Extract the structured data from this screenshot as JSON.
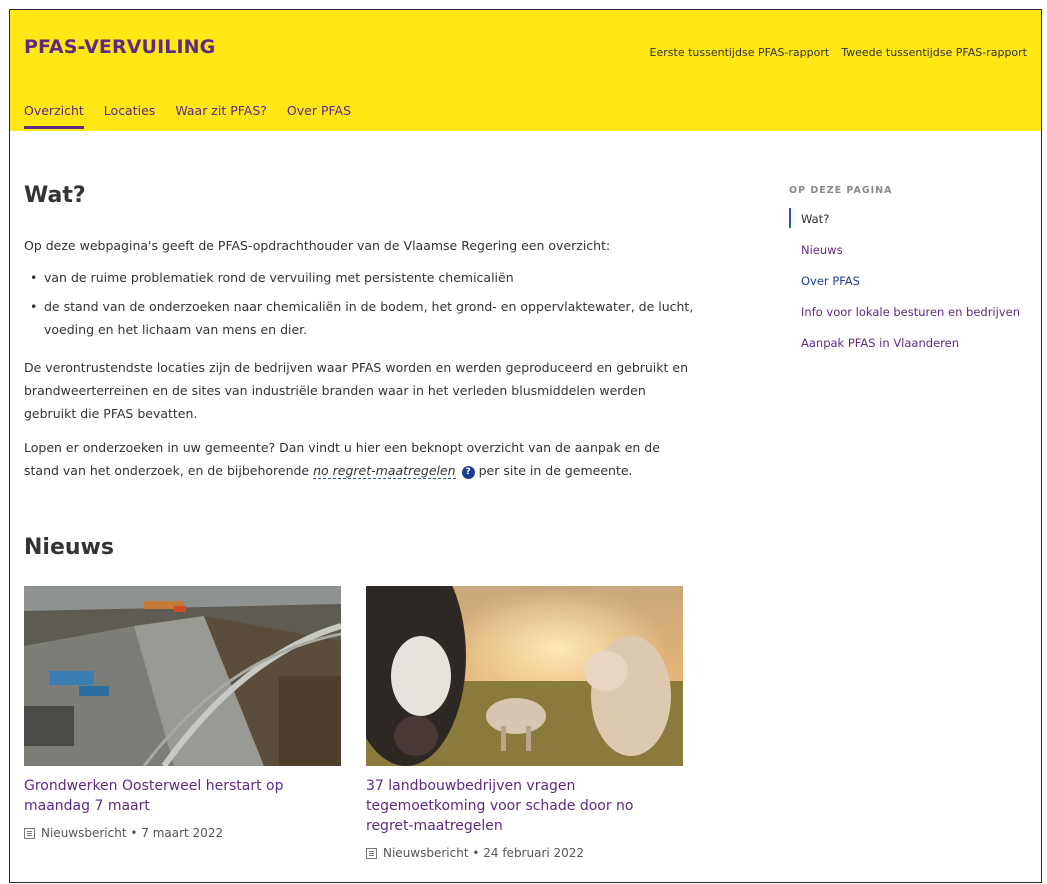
{
  "header": {
    "site_title": "PFAS-VERVUILING",
    "top_links": [
      "Eerste tussentijdse PFAS-rapport",
      "Tweede tussentijdse PFAS-rapport"
    ],
    "nav": [
      "Overzicht",
      "Locaties",
      "Waar zit PFAS?",
      "Over PFAS"
    ],
    "active_nav": "Overzicht"
  },
  "wat": {
    "title": "Wat?",
    "intro": "Op deze webpagina's geeft de PFAS-opdrachthouder van de Vlaamse Regering een overzicht:",
    "bullets": [
      "van de ruime problematiek rond de vervuiling met persistente chemicaliën",
      "de stand van de onderzoeken naar chemicaliën in de bodem, het grond- en oppervlaktewater, de lucht, voeding en het lichaam van mens en dier."
    ],
    "paragraph2": "De verontrustendste locaties zijn de bedrijven waar PFAS worden en werden geproduceerd en gebruikt en brandweerterreinen en de sites van industriële branden waar in het verleden blusmiddelen werden gebruikt die PFAS bevatten.",
    "paragraph3_before": "Lopen er onderzoeken in uw gemeente? Dan vindt u hier een beknopt overzicht van de aanpak en de stand van het onderzoek, en de bijbehorende ",
    "paragraph3_term": "no regret-maatregelen",
    "paragraph3_help": "?",
    "paragraph3_after": "per site in de gemeente."
  },
  "nieuws": {
    "title": "Nieuws",
    "cards": [
      {
        "title": "Grondwerken Oosterweel herstart op maandag 7 maart",
        "meta": "Nieuwsbericht • 7 maart 2022"
      },
      {
        "title": "37 landbouwbedrijven vragen tegemoetkoming voor schade door no regret-maatregelen",
        "meta": "Nieuwsbericht • 24 februari 2022"
      }
    ]
  },
  "toc": {
    "heading": "OP DEZE PAGINA",
    "items": [
      "Wat?",
      "Nieuws",
      "Over PFAS",
      "Info voor lokale besturen en bedrijven",
      "Aanpak PFAS in Vlaanderen"
    ],
    "current": "Wat?"
  },
  "colors": {
    "header_bg": "#ffe615",
    "brand_purple": "#5e2a84",
    "link_blue": "#1b3f8f"
  }
}
